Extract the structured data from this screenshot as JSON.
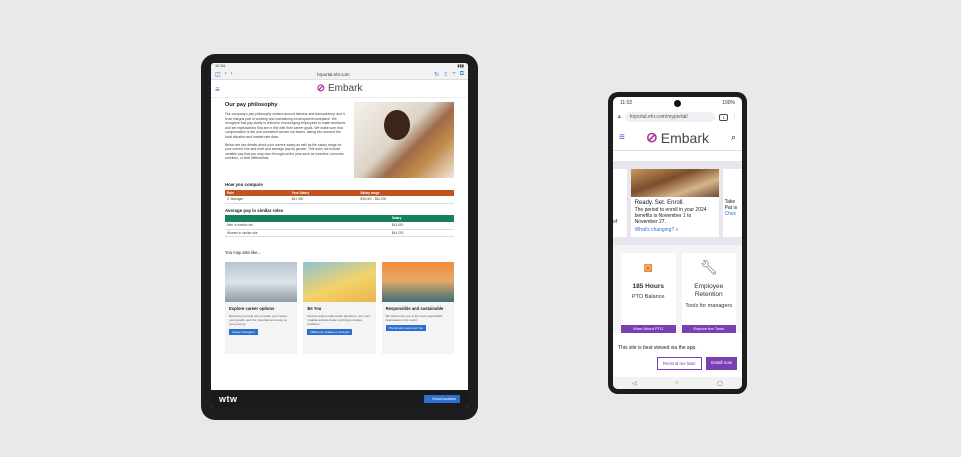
{
  "tablet": {
    "status_time": "12:34",
    "url": "hrportal.ehr.com",
    "brand": "Embark",
    "hero_title": "Our pay philosophy",
    "hero_p1": "Our company's pay philosophy centers around fairness and transparency, and it is an integral part of creating and maintaining a transparent workplace. We recognize that pay clarity is critical to encouraging employees to make decisions and set expectations that are in line with their career goals. We make sure that compensation is fair and consistent across our teams, taking into account the local situation and market rate data.",
    "hero_p2": "Below are key details about your current salary as well as the salary range for your current role and level and average pay by gender. This does not include variable pay that you may earn throughout the year such as incentive, bonuses, overtime, or shift differentials.",
    "compare_title": "How you compare",
    "compare_headers": [
      "Role",
      "Your Salary",
      "Salary range"
    ],
    "compare_row": [
      "IT Manager",
      "$41,300",
      "$35,000 - $50,000"
    ],
    "avg_title": "Average pay in similar roles",
    "avg_header": "Salary",
    "avg_rows": [
      {
        "label": "Men in similar role",
        "value": "$43,500"
      },
      {
        "label": "Women in similar role",
        "value": "$44,200"
      }
    ],
    "also_title": "You may also like...",
    "cards": [
      {
        "title": "Explore career options",
        "text": "Resources to help you consider your career, your growth, and the potential next steps on your journey.",
        "button": "Career Navigator"
      },
      {
        "title": "Be You",
        "text": "Diverse teams make better decisions, are more creative and are better at driving complex problems.",
        "button": "Difference makes us stronger"
      },
      {
        "title": "Responsible and sustainable",
        "text": "We want to be one of the most responsible businesses in the world.",
        "button": "The Environment and You"
      }
    ],
    "footer_logo": "wtw",
    "assistant_label": "Virtual Assistant"
  },
  "phone": {
    "status_time": "11:02",
    "battery": "100%",
    "url": "hrportal.ehr.com/myportal/",
    "tab_count": "1",
    "brand": "Embark",
    "promo_left": "of",
    "promo_title": "Ready. Set. Enroll.",
    "promo_text": "The period to enroll in your 2024 benefits is November 1 to November 27.",
    "promo_link": "What's changing? »",
    "promo_right": "Take",
    "promo_right2": "Pat is",
    "promo_right_link": "Chec",
    "tile1_value": "185 Hours",
    "tile1_label": "PTO Balance",
    "tile1_button": "More About PTO",
    "tile2_title": "Employee Retention",
    "tile2_label": "Tools for managers",
    "tile2_button": "Explore the Tools",
    "banner_text": "This site is best viewed via the app.",
    "remind_label": "Remind me later",
    "install_label": "Install now"
  }
}
